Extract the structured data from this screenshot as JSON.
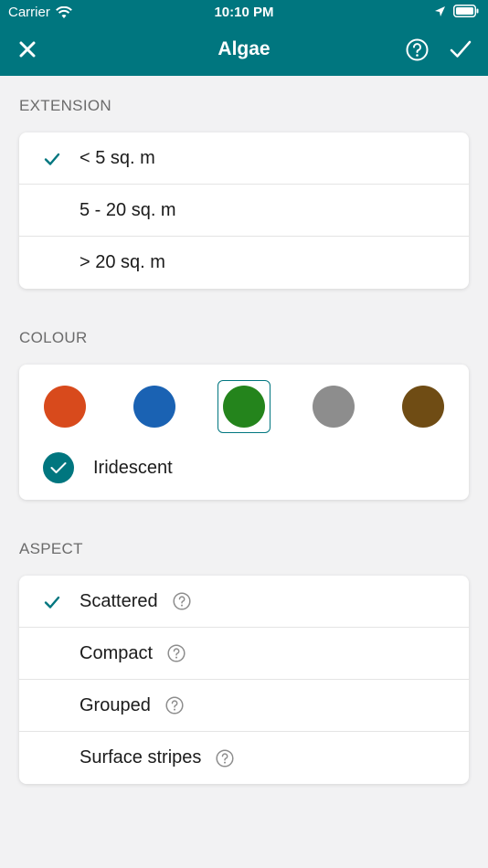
{
  "status_bar": {
    "carrier": "Carrier",
    "time": "10:10 PM"
  },
  "nav": {
    "title": "Algae",
    "close_icon": "close-icon",
    "help_icon": "help-circle-icon",
    "confirm_icon": "check-icon"
  },
  "extension": {
    "label": "EXTENSION",
    "options": [
      {
        "label": "< 5 sq. m",
        "selected": true
      },
      {
        "label": "5 - 20 sq. m",
        "selected": false
      },
      {
        "label": "> 20 sq. m",
        "selected": false
      }
    ]
  },
  "colour": {
    "label": "COLOUR",
    "swatches": [
      {
        "name": "orange",
        "color": "#d84a1c",
        "selected": false
      },
      {
        "name": "blue",
        "color": "#1a62b3",
        "selected": false
      },
      {
        "name": "green",
        "color": "#24841c",
        "selected": true
      },
      {
        "name": "grey",
        "color": "#8d8d8d",
        "selected": false
      },
      {
        "name": "brown",
        "color": "#6f4c14",
        "selected": false
      }
    ],
    "iridescent_label": "Iridescent",
    "iridescent_checked": true
  },
  "aspect": {
    "label": "ASPECT",
    "options": [
      {
        "label": "Scattered",
        "selected": true
      },
      {
        "label": "Compact",
        "selected": false
      },
      {
        "label": "Grouped",
        "selected": false
      },
      {
        "label": "Surface stripes",
        "selected": false
      }
    ]
  },
  "colors": {
    "accent": "#00767f",
    "background": "#f2f2f3"
  }
}
